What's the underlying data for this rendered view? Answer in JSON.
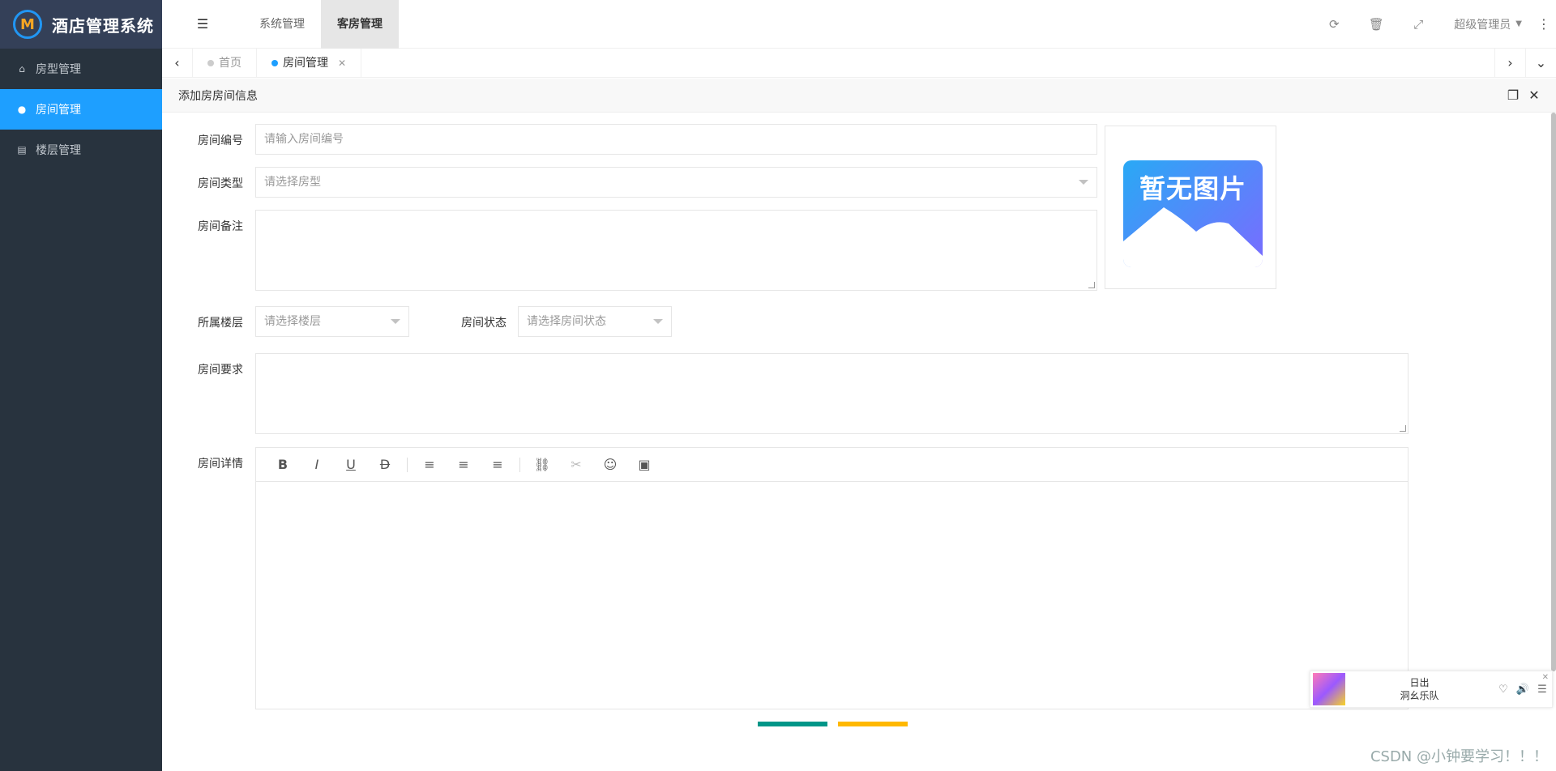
{
  "app": {
    "title": "酒店管理系统",
    "logo_letter": "M"
  },
  "sidebar": {
    "items": [
      {
        "label": "房型管理",
        "icon": "home-icon"
      },
      {
        "label": "房间管理",
        "icon": "users-icon"
      },
      {
        "label": "楼层管理",
        "icon": "building-icon"
      }
    ]
  },
  "header": {
    "tabs": [
      {
        "label": "系统管理"
      },
      {
        "label": "客房管理"
      }
    ],
    "user": "超级管理员"
  },
  "tabs": [
    {
      "label": "首页"
    },
    {
      "label": "房间管理"
    }
  ],
  "dialog": {
    "title": "添加房房间信息"
  },
  "form": {
    "room_no_label": "房间编号",
    "room_no_placeholder": "请输入房间编号",
    "room_type_label": "房间类型",
    "room_type_placeholder": "请选择房型",
    "remark_label": "房间备注",
    "floor_label": "所属楼层",
    "floor_placeholder": "请选择楼层",
    "status_label": "房间状态",
    "status_placeholder": "请选择房间状态",
    "require_label": "房间要求",
    "detail_label": "房间详情"
  },
  "preview": {
    "text": "暂无图片"
  },
  "editor": {
    "tools": [
      "B",
      "I",
      "U",
      "D",
      "≡",
      "≡",
      "≡",
      "⛓",
      "✂",
      "☺",
      "▣"
    ]
  },
  "player": {
    "song": "日出",
    "artist": "洞幺乐队"
  },
  "watermark": "CSDN @小钟要学习！！！",
  "colors": {
    "accent": "#1e9fff",
    "sidebar_bg": "#28333e",
    "btn_green": "#009688",
    "btn_yellow": "#ffb800"
  }
}
